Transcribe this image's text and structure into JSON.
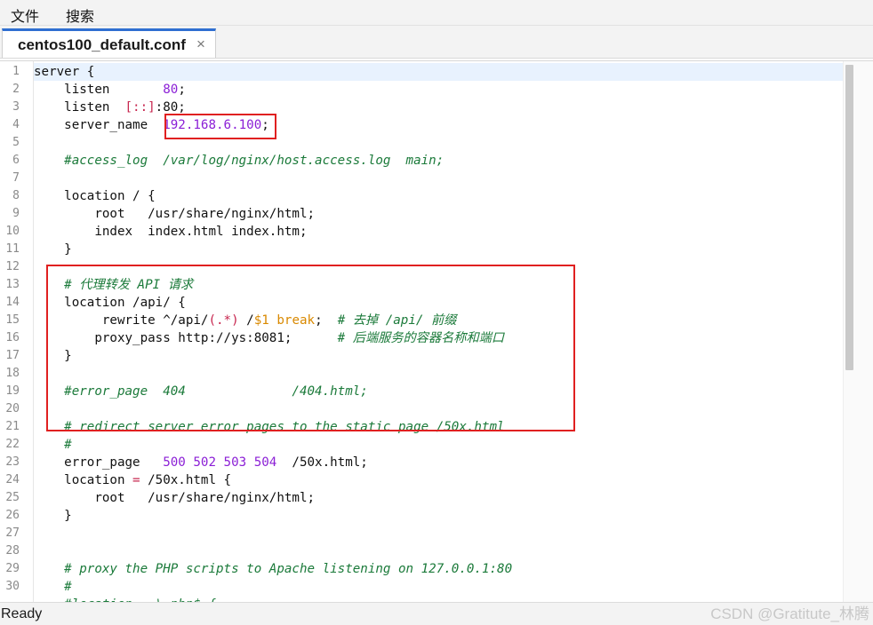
{
  "menu": {
    "file": "文件",
    "search": "搜索"
  },
  "tab": {
    "title": "centos100_default.conf",
    "close_glyph": "×"
  },
  "editor": {
    "line_numbers": [
      "1",
      "2",
      "3",
      "4",
      "5",
      "6",
      "7",
      "8",
      "9",
      "10",
      "11",
      "12",
      "13",
      "14",
      "15",
      "16",
      "17",
      "18",
      "19",
      "20",
      "21",
      "22",
      "23",
      "24",
      "25",
      "26",
      "27",
      "28",
      "29",
      "30"
    ],
    "lines": [
      [
        [
          "server {",
          "t-plain"
        ]
      ],
      [
        [
          "    listen       ",
          "t-plain"
        ],
        [
          "80",
          "t-num"
        ],
        [
          ";",
          "t-plain"
        ]
      ],
      [
        [
          "    listen  ",
          "t-plain"
        ],
        [
          "[::]",
          "t-red"
        ],
        [
          ":80;",
          "t-plain"
        ]
      ],
      [
        [
          "    server_name  ",
          "t-plain"
        ],
        [
          "192.168.6.100",
          "t-num"
        ],
        [
          ";",
          "t-plain"
        ]
      ],
      [
        [
          "",
          "t-plain"
        ]
      ],
      [
        [
          "    #access_log  /var/log/nginx/host.access.log  main;",
          "t-comment"
        ]
      ],
      [
        [
          "",
          "t-plain"
        ]
      ],
      [
        [
          "    location / {",
          "t-plain"
        ]
      ],
      [
        [
          "        root   /usr/share/nginx/html;",
          "t-plain"
        ]
      ],
      [
        [
          "        index  index.html index.htm;",
          "t-plain"
        ]
      ],
      [
        [
          "    }",
          "t-plain"
        ]
      ],
      [
        [
          "",
          "t-plain"
        ]
      ],
      [
        [
          "    # 代理转发 API 请求",
          "t-comment"
        ]
      ],
      [
        [
          "    location /api/ {",
          "t-plain"
        ]
      ],
      [
        [
          "         rewrite ^/api/",
          "t-plain"
        ],
        [
          "(.*)",
          "t-red"
        ],
        [
          " /",
          "t-plain"
        ],
        [
          "$1",
          "t-var"
        ],
        [
          " break",
          "t-var"
        ],
        [
          ";  ",
          "t-plain"
        ],
        [
          "# 去掉 /api/ 前缀",
          "t-comment"
        ]
      ],
      [
        [
          "        proxy_pass http://ys:8081;      ",
          "t-plain"
        ],
        [
          "# 后端服务的容器名称和端口",
          "t-comment"
        ]
      ],
      [
        [
          "    }",
          "t-plain"
        ]
      ],
      [
        [
          "",
          "t-plain"
        ]
      ],
      [
        [
          "    #error_page  404              /404.html;",
          "t-comment"
        ]
      ],
      [
        [
          "",
          "t-plain"
        ]
      ],
      [
        [
          "    # redirect server error pages to the static page /50x.html",
          "t-comment"
        ]
      ],
      [
        [
          "    #",
          "t-comment"
        ]
      ],
      [
        [
          "    error_page   ",
          "t-plain"
        ],
        [
          "500 502 503 504",
          "t-num"
        ],
        [
          "  /50x.html;",
          "t-plain"
        ]
      ],
      [
        [
          "    location ",
          "t-plain"
        ],
        [
          "=",
          "t-red"
        ],
        [
          " /50x.html {",
          "t-plain"
        ]
      ],
      [
        [
          "        root   /usr/share/nginx/html;",
          "t-plain"
        ]
      ],
      [
        [
          "    }",
          "t-plain"
        ]
      ],
      [
        [
          "",
          "t-plain"
        ]
      ],
      [
        [
          "",
          "t-plain"
        ]
      ],
      [
        [
          "    # proxy the PHP scripts to Apache listening on 127.0.0.1:80",
          "t-comment"
        ]
      ],
      [
        [
          "    #",
          "t-comment"
        ]
      ],
      [
        [
          "    #location ~ \\.php$ {",
          "t-comment"
        ]
      ]
    ]
  },
  "status": {
    "text": "Ready"
  },
  "watermark": "CSDN @Gratitute_林腾"
}
